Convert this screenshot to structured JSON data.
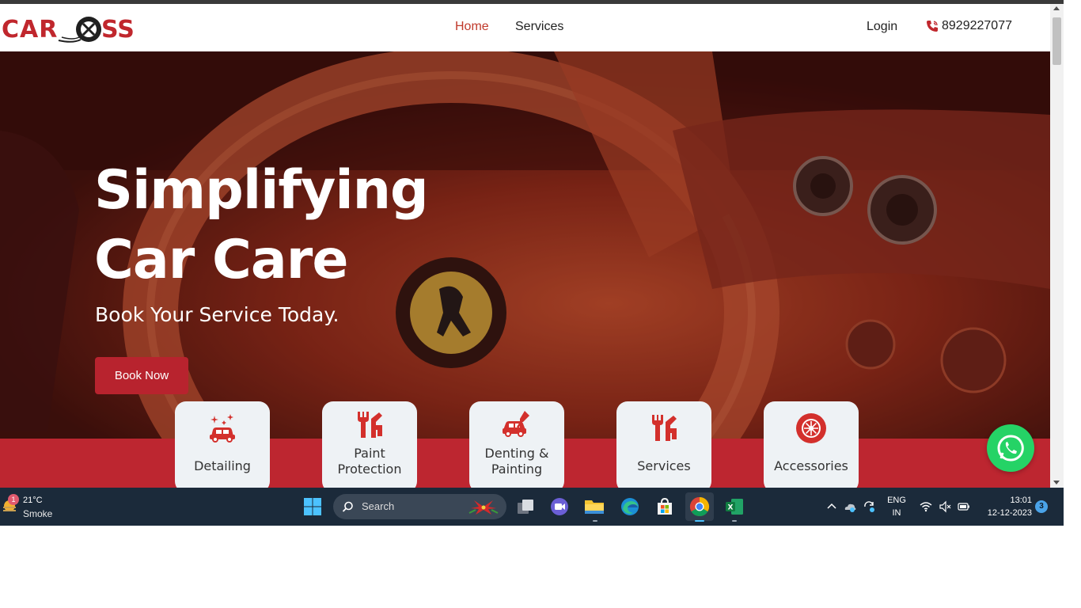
{
  "site": {
    "logo_text": "CAROSS",
    "nav": {
      "home": "Home",
      "services": "Services",
      "login": "Login",
      "phone": "8929227077"
    },
    "hero": {
      "title_line1": "Simplifying",
      "title_line2": "Car Care",
      "subtitle": "Book Your Service Today.",
      "cta": "Book Now"
    },
    "cards": [
      {
        "line1": "Detailing",
        "line2": "",
        "icon": "car-sparkle-icon"
      },
      {
        "line1": "Paint",
        "line2": "Protection",
        "icon": "tools-icon"
      },
      {
        "line1": "Denting &",
        "line2": "Painting",
        "icon": "car-paint-icon"
      },
      {
        "line1": "Services",
        "line2": "",
        "icon": "tools-icon"
      },
      {
        "line1": "Accessories",
        "line2": "",
        "icon": "wheel-icon"
      }
    ],
    "colors": {
      "brand_red": "#bd2630",
      "accent_nav": "#c0392b",
      "whatsapp_green": "#25d366"
    }
  },
  "taskbar": {
    "weather": {
      "temp": "21°C",
      "desc": "Smoke",
      "badge": "1"
    },
    "search_placeholder": "Search",
    "tray": {
      "lang_top": "ENG",
      "lang_bottom": "IN",
      "time": "13:01",
      "date": "12-12-2023",
      "notifications": "3"
    }
  }
}
